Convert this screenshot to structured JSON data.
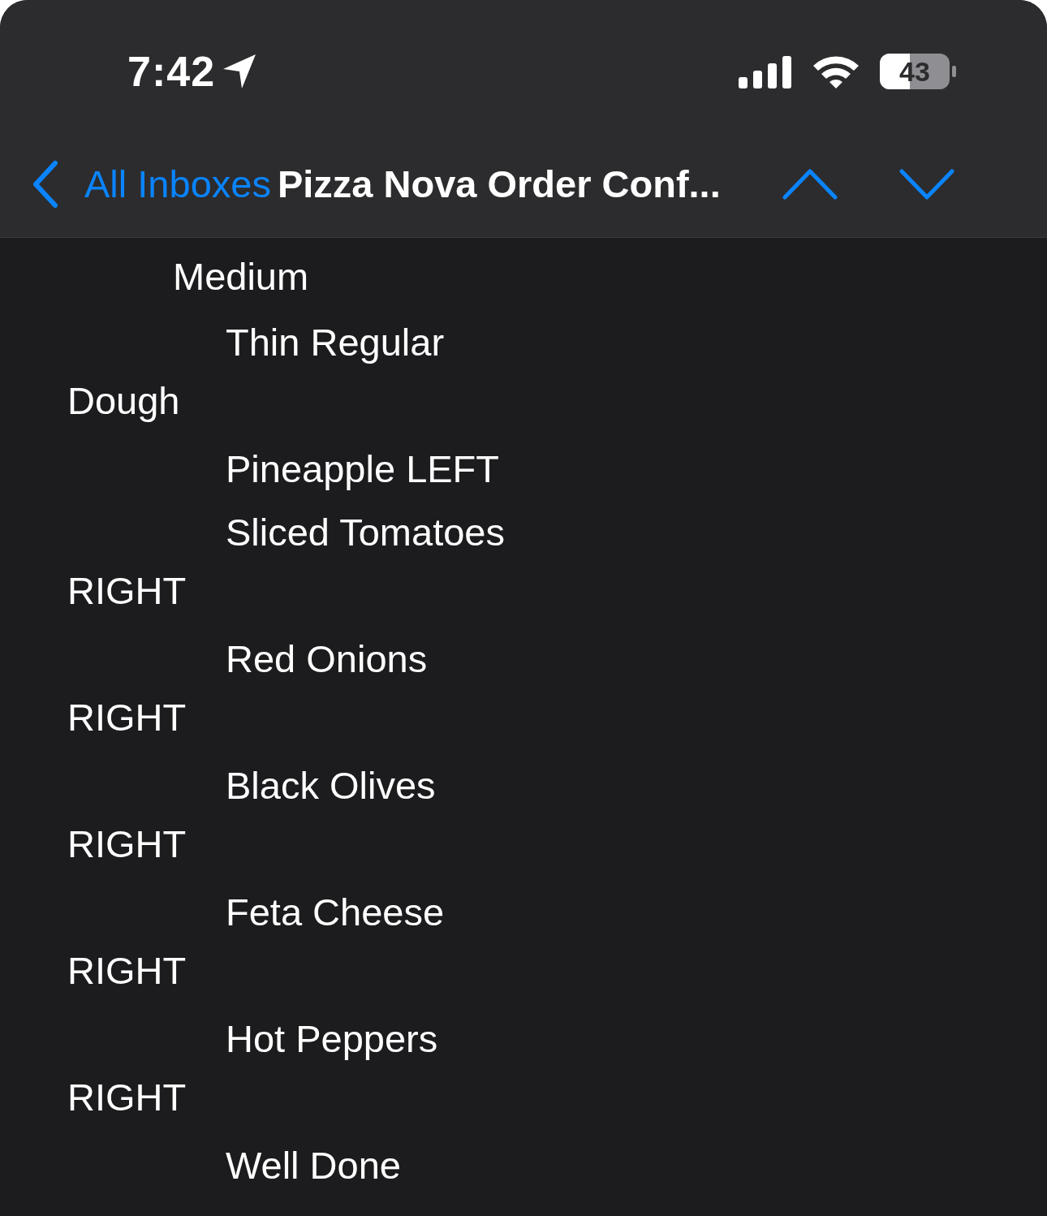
{
  "status_bar": {
    "time": "7:42",
    "battery": "43"
  },
  "nav": {
    "back_label": "All Inboxes",
    "title": "Pizza Nova Order Conf..."
  },
  "lines": [
    {
      "text": "Medium",
      "kind": "option"
    },
    {
      "text": "Thin Regular",
      "kind": "item"
    },
    {
      "text": "Dough",
      "kind": "label"
    },
    {
      "text": "Pineapple LEFT",
      "kind": "item"
    },
    {
      "text": "Sliced Tomatoes",
      "kind": "item"
    },
    {
      "text": "RIGHT",
      "kind": "label"
    },
    {
      "text": "Red Onions",
      "kind": "item"
    },
    {
      "text": "RIGHT",
      "kind": "label"
    },
    {
      "text": "Black Olives",
      "kind": "item"
    },
    {
      "text": "RIGHT",
      "kind": "label"
    },
    {
      "text": "Feta Cheese",
      "kind": "item"
    },
    {
      "text": "RIGHT",
      "kind": "label"
    },
    {
      "text": "Hot Peppers",
      "kind": "item"
    },
    {
      "text": "RIGHT",
      "kind": "label"
    },
    {
      "text": "Well Done",
      "kind": "item"
    }
  ]
}
